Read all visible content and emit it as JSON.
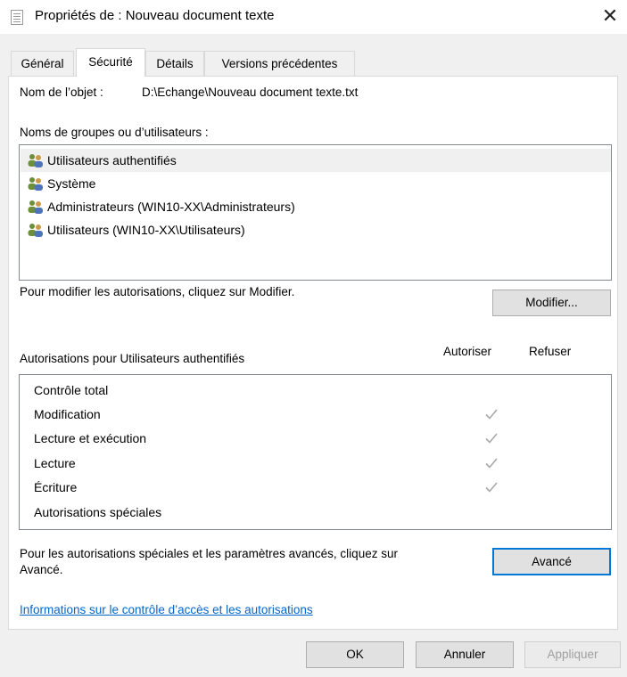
{
  "window": {
    "title": "Propriétés de : Nouveau document texte",
    "close_glyph": "✕"
  },
  "tabs": [
    {
      "label": "Général",
      "active": false
    },
    {
      "label": "Sécurité",
      "active": true
    },
    {
      "label": "Détails",
      "active": false
    },
    {
      "label": "Versions précédentes",
      "active": false
    }
  ],
  "object": {
    "label": "Nom de l’objet :",
    "value": "D:\\Echange\\Nouveau document texte.txt"
  },
  "groups": {
    "label": "Noms de groupes ou d’utilisateurs :",
    "items": [
      {
        "label": "Utilisateurs authentifiés",
        "selected": true
      },
      {
        "label": "Système",
        "selected": false
      },
      {
        "label": "Administrateurs (WIN10-XX\\Administrateurs)",
        "selected": false
      },
      {
        "label": "Utilisateurs (WIN10-XX\\Utilisateurs)",
        "selected": false
      }
    ]
  },
  "modify": {
    "hint": "Pour modifier les autorisations, cliquez sur Modifier.",
    "button": "Modifier..."
  },
  "permissions": {
    "label": "Autorisations pour Utilisateurs authentifiés",
    "allow_header": "Autoriser",
    "deny_header": "Refuser",
    "rows": [
      {
        "label": "Contrôle total",
        "allow": false,
        "deny": false
      },
      {
        "label": "Modification",
        "allow": true,
        "deny": false
      },
      {
        "label": "Lecture et exécution",
        "allow": true,
        "deny": false
      },
      {
        "label": "Lecture",
        "allow": true,
        "deny": false
      },
      {
        "label": "Écriture",
        "allow": true,
        "deny": false
      },
      {
        "label": "Autorisations spéciales",
        "allow": false,
        "deny": false
      }
    ]
  },
  "advanced": {
    "hint_line1": "Pour les autorisations spéciales et les paramètres avancés, cliquez sur",
    "hint_line2": "Avancé.",
    "button": "Avancé"
  },
  "help_link": "Informations sur le contrôle d’accès et les autorisations",
  "footer": {
    "ok": "OK",
    "cancel": "Annuler",
    "apply": "Appliquer"
  },
  "colors": {
    "accent": "#0078d7",
    "link": "#0066cc",
    "check": "#a8a8a8"
  }
}
